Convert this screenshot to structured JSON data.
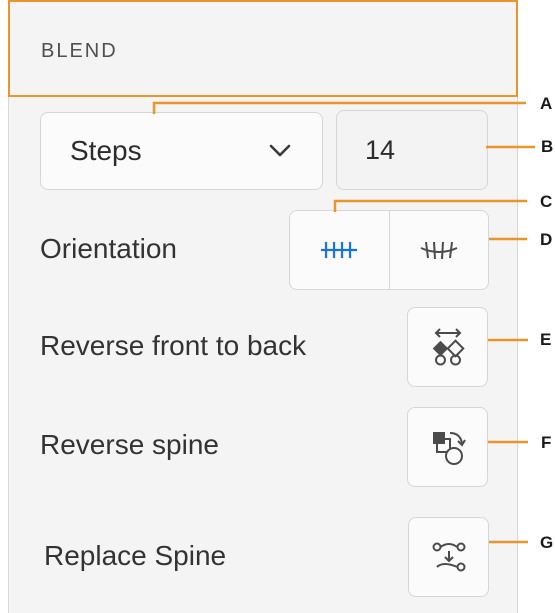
{
  "panel": {
    "title": "BLEND"
  },
  "blend_mode": {
    "selected": "Steps"
  },
  "steps_count": "14",
  "labels": {
    "orientation": "Orientation",
    "reverse_front_to_back": "Reverse front to back",
    "reverse_spine": "Reverse spine",
    "replace_spine": "Replace Spine"
  },
  "callouts": [
    "A",
    "B",
    "C",
    "D",
    "E",
    "F",
    "G"
  ],
  "colors": {
    "accent": "#e8952e",
    "selected_icon": "#1473e6",
    "icon": "#4b4b4b"
  },
  "icons": {
    "dropdown": "chevron-down-icon",
    "orient_page": "orientation-page-icon",
    "orient_path": "orientation-path-icon",
    "reverse_front_back": "reverse-front-back-icon",
    "reverse_spine": "reverse-spine-icon",
    "replace_spine": "replace-spine-icon"
  }
}
